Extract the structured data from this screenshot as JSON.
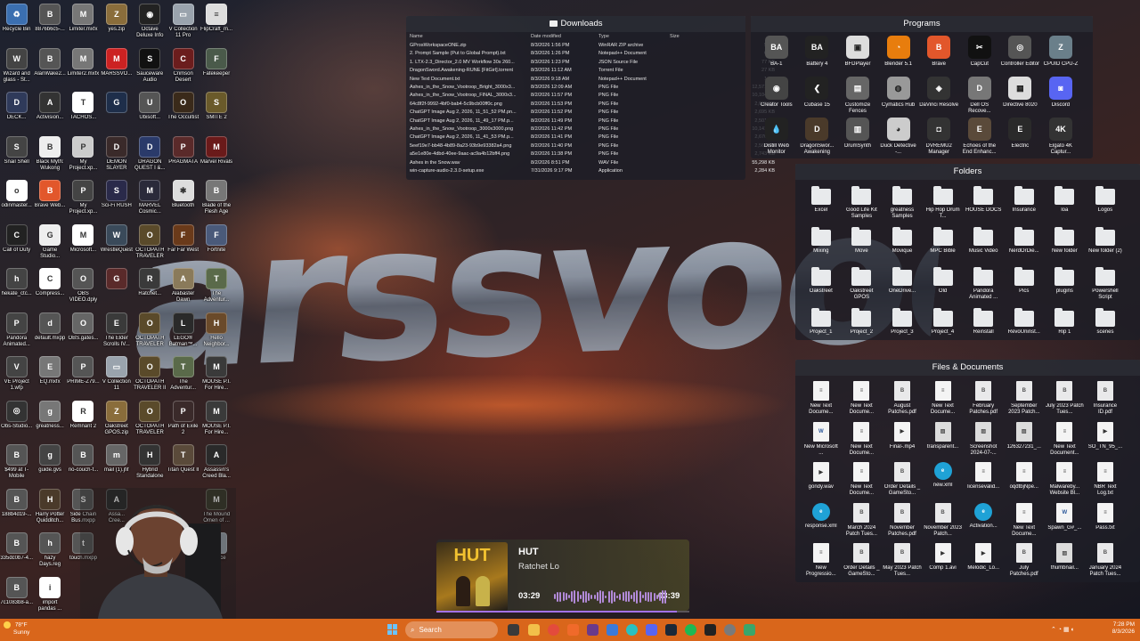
{
  "wallpaper": {
    "title": "arssvoodoo"
  },
  "desktop_icons": [
    {
      "label": "Recycle Bin",
      "icon": "recycle-bin",
      "color": "#3b6fb0",
      "glyph": "♻"
    },
    {
      "label": "8876b6c5-...",
      "icon": "brave",
      "color": "#555",
      "glyph": "B"
    },
    {
      "label": "Limiter.mxfx",
      "icon": "audio",
      "color": "#777",
      "glyph": "M"
    },
    {
      "label": "yes.zip",
      "icon": "zip",
      "color": "#8a6d3b",
      "glyph": "Z"
    },
    {
      "label": "Octave Deluxe Info",
      "icon": "octave",
      "color": "#222",
      "glyph": "◉"
    },
    {
      "label": "V Collection 11 Pro",
      "icon": "folder",
      "color": "#9aa3ad",
      "glyph": "▭"
    },
    {
      "label": "FlipCraft_m...",
      "icon": "document",
      "color": "#ddd",
      "glyph": "≡"
    },
    {
      "label": "Wizard and glass - St...",
      "icon": "document",
      "color": "#444",
      "glyph": "W"
    },
    {
      "label": "AlanWake2...",
      "icon": "brave",
      "color": "#555",
      "glyph": "B"
    },
    {
      "label": "Limiter2.mxfx",
      "icon": "audio",
      "color": "#777",
      "glyph": "M"
    },
    {
      "label": "MARSSVO...",
      "icon": "document",
      "color": "#c22",
      "glyph": "M"
    },
    {
      "label": "Sauceware Audio",
      "icon": "app",
      "color": "#111",
      "glyph": "S"
    },
    {
      "label": "Crimson Desert",
      "icon": "game",
      "color": "#6b1d1d",
      "glyph": "C"
    },
    {
      "label": "Fatekeeper",
      "icon": "game",
      "color": "#4a5a4a",
      "glyph": "F"
    },
    {
      "label": "DECK...",
      "icon": "game",
      "color": "#2f3a5a",
      "glyph": "D"
    },
    {
      "label": "Activision...",
      "icon": "shortcut",
      "color": "#333",
      "glyph": "A"
    },
    {
      "label": "TACHOS...",
      "icon": "document",
      "color": "#fff",
      "glyph": "T"
    },
    {
      "label": "",
      "icon": "game",
      "color": "#1e2e4a",
      "glyph": "G"
    },
    {
      "label": "Ubisoft...",
      "icon": "brave",
      "color": "#555",
      "glyph": "U"
    },
    {
      "label": "The Occultist",
      "icon": "game",
      "color": "#3a2a1a",
      "glyph": "O"
    },
    {
      "label": "SMITE 2",
      "icon": "game",
      "color": "#6a5a2a",
      "glyph": "S"
    },
    {
      "label": "Snail Shell",
      "icon": "game",
      "color": "#444",
      "glyph": "S"
    },
    {
      "label": "Black Myth: Wukong",
      "icon": "document",
      "color": "#eee",
      "glyph": "B"
    },
    {
      "label": "My Project.xp...",
      "icon": "document",
      "color": "#ccc",
      "glyph": "P"
    },
    {
      "label": "DEMON SLAYER",
      "icon": "game",
      "color": "#3a2a2a",
      "glyph": "D"
    },
    {
      "label": "DRAGON QUEST I &...",
      "icon": "game",
      "color": "#2a3a6a",
      "glyph": "D"
    },
    {
      "label": "PRAGMATA",
      "icon": "game",
      "color": "#5a2a2a",
      "glyph": "P"
    },
    {
      "label": "Marvel Rivals",
      "icon": "game",
      "color": "#6a1a1a",
      "glyph": "M"
    },
    {
      "label": "odinmaster...",
      "icon": "document",
      "color": "#fff",
      "glyph": "o"
    },
    {
      "label": "Brave Web...",
      "icon": "brave",
      "color": "#e2572b",
      "glyph": "B"
    },
    {
      "label": "My Project.xp...",
      "icon": "document",
      "color": "#444",
      "glyph": "P"
    },
    {
      "label": "Sci-Fi RUSH",
      "icon": "game",
      "color": "#2a2a4a",
      "glyph": "S"
    },
    {
      "label": "MARVEL Cosmic...",
      "icon": "game",
      "color": "#2a2a3a",
      "glyph": "M"
    },
    {
      "label": "Bluetooth",
      "icon": "bluetooth",
      "color": "#ddd",
      "glyph": "✱"
    },
    {
      "label": "Blade of the Flesh Age",
      "icon": "game",
      "color": "#777",
      "glyph": "B"
    },
    {
      "label": "Call of Duty",
      "icon": "game",
      "color": "#222",
      "glyph": "C"
    },
    {
      "label": "Game Studio...",
      "icon": "document",
      "color": "#eee",
      "glyph": "G"
    },
    {
      "label": "Microsoft...",
      "icon": "document",
      "color": "#fff",
      "glyph": "M"
    },
    {
      "label": "WrestleQuest",
      "icon": "game",
      "color": "#3a4a5a",
      "glyph": "W"
    },
    {
      "label": "OCTOPATH TRAVELER",
      "icon": "game",
      "color": "#5a4a2a",
      "glyph": "O"
    },
    {
      "label": "Far Far West",
      "icon": "game",
      "color": "#6a3a1a",
      "glyph": "F"
    },
    {
      "label": "Fortnite",
      "icon": "game",
      "color": "#4a5a7a",
      "glyph": "F"
    },
    {
      "label": "hekate_ctc...",
      "icon": "document",
      "color": "#444",
      "glyph": "h"
    },
    {
      "label": "Compress...",
      "icon": "document",
      "color": "#fff",
      "glyph": "C"
    },
    {
      "label": "OBS VIDEO.dply",
      "icon": "document",
      "color": "#555",
      "glyph": "O"
    },
    {
      "label": "",
      "icon": "game",
      "color": "#5a2a2a",
      "glyph": "G"
    },
    {
      "label": "Ratchet...",
      "icon": "game",
      "color": "#3a3a3a",
      "glyph": "R"
    },
    {
      "label": "Alabaster Dawn",
      "icon": "game",
      "color": "#8a7a5a",
      "glyph": "A"
    },
    {
      "label": "The Adventur...",
      "icon": "game",
      "color": "#5a6a4a",
      "glyph": "T"
    },
    {
      "label": "Pandora Animated...",
      "icon": "document",
      "color": "#444",
      "glyph": "P"
    },
    {
      "label": "default.mxpp",
      "icon": "document",
      "color": "#555",
      "glyph": "d"
    },
    {
      "label": "OBS.gates...",
      "icon": "document",
      "color": "#666",
      "glyph": "O"
    },
    {
      "label": "The Elder Scrolls IV...",
      "icon": "game",
      "color": "#3a3a3a",
      "glyph": "E"
    },
    {
      "label": "OCTOPATH TRAVELER",
      "icon": "game",
      "color": "#5a4a2a",
      "glyph": "O"
    },
    {
      "label": "LEGO® Batman™...",
      "icon": "game",
      "color": "#2a2a2a",
      "glyph": "L"
    },
    {
      "label": "Hello Neighbor...",
      "icon": "game",
      "color": "#6a4a2a",
      "glyph": "H"
    },
    {
      "label": "VE Project 1.wfp",
      "icon": "document",
      "color": "#444",
      "glyph": "V"
    },
    {
      "label": "EQ.mxfx",
      "icon": "audio",
      "color": "#777",
      "glyph": "E"
    },
    {
      "label": "PRIME-Z79...",
      "icon": "document",
      "color": "#555",
      "glyph": "P"
    },
    {
      "label": "V Collection 11",
      "icon": "folder",
      "color": "#9aa3ad",
      "glyph": "▭"
    },
    {
      "label": "OCTOPATH TRAVELER II",
      "icon": "game",
      "color": "#5a4a2a",
      "glyph": "O"
    },
    {
      "label": "The Adventur...",
      "icon": "game",
      "color": "#5a6a4a",
      "glyph": "T"
    },
    {
      "label": "MOUSE P.I. For Hire...",
      "icon": "game",
      "color": "#3a3a3a",
      "glyph": "M"
    },
    {
      "label": "Obs-Studio...",
      "icon": "app",
      "color": "#333",
      "glyph": "◎"
    },
    {
      "label": "greatness...",
      "icon": "audio",
      "color": "#777",
      "glyph": "g"
    },
    {
      "label": "Remnant 2",
      "icon": "document",
      "color": "#fff",
      "glyph": "R"
    },
    {
      "label": "Oakstreet GPOS.zip",
      "icon": "zip",
      "color": "#8a6d3b",
      "glyph": "Z"
    },
    {
      "label": "OCTOPATH TRAVELER",
      "icon": "game",
      "color": "#5a4a2a",
      "glyph": "O"
    },
    {
      "label": "Path of Exile 2",
      "icon": "game",
      "color": "#3a2a2a",
      "glyph": "P"
    },
    {
      "label": "MOUSE P.I. For Hire...",
      "icon": "game",
      "color": "#3a3a3a",
      "glyph": "M"
    },
    {
      "label": "$499 at T-Mobile",
      "icon": "brave",
      "color": "#555",
      "glyph": "B"
    },
    {
      "label": "guide.gvs",
      "icon": "document",
      "color": "#444",
      "glyph": "g"
    },
    {
      "label": "rio-couch-f...",
      "icon": "brave",
      "color": "#555",
      "glyph": "B"
    },
    {
      "label": "mail (1).jfif",
      "icon": "document",
      "color": "#666",
      "glyph": "m"
    },
    {
      "label": "Hybrid Standalone",
      "icon": "app",
      "color": "#333",
      "glyph": "H"
    },
    {
      "label": "Titan Quest II",
      "icon": "game",
      "color": "#5a4a3a",
      "glyph": "T"
    },
    {
      "label": "Assassin's Creed Bla...",
      "icon": "game",
      "color": "#2a2a2a",
      "glyph": "A"
    },
    {
      "label": "188b4d19-...",
      "icon": "brave",
      "color": "#555",
      "glyph": "B"
    },
    {
      "label": "Harry Potter Quidditch...",
      "icon": "game",
      "color": "#4a3a2a",
      "glyph": "H"
    },
    {
      "label": "Side Chain Bus.mxpp",
      "icon": "document",
      "color": "#555",
      "glyph": "S"
    },
    {
      "label": "Assa... Cree...",
      "icon": "game",
      "color": "#2a2a2a",
      "glyph": "A"
    },
    {
      "label": "",
      "icon": "blank",
      "color": "transparent",
      "glyph": ""
    },
    {
      "label": "",
      "icon": "blank",
      "color": "transparent",
      "glyph": ""
    },
    {
      "label": "The Mound Omen of ...",
      "icon": "game",
      "color": "#3a3a2a",
      "glyph": "M"
    },
    {
      "label": "335dc0b7-4...",
      "icon": "brave",
      "color": "#555",
      "glyph": "B"
    },
    {
      "label": "hazy Days.reg",
      "icon": "document",
      "color": "#555",
      "glyph": "h"
    },
    {
      "label": "touch.mxpp",
      "icon": "document",
      "color": "#555",
      "glyph": "t"
    },
    {
      "label": "",
      "icon": "blank",
      "color": "transparent",
      "glyph": ""
    },
    {
      "label": "",
      "icon": "blank",
      "color": "transparent",
      "glyph": ""
    },
    {
      "label": "",
      "icon": "blank",
      "color": "transparent",
      "glyph": ""
    },
    {
      "label": "...space",
      "icon": "folder",
      "color": "#9aa3ad",
      "glyph": "▭"
    },
    {
      "label": "7c1083b8-a...",
      "icon": "brave",
      "color": "#555",
      "glyph": "B"
    },
    {
      "label": "import pandas ...",
      "icon": "document",
      "color": "#fff",
      "glyph": "i"
    }
  ],
  "downloads": {
    "title": "Downloads",
    "columns": [
      "Name",
      "Date modified",
      "Type",
      "Size"
    ],
    "rows": [
      [
        "GProsWorkspaceONE.zip",
        "8/3/2026 1:56 PM",
        "WinRAR ZIP archive",
        "5 KB"
      ],
      [
        "2. Prompt Sample (Put to Global Prompt).txt",
        "8/3/2026 1:26 PM",
        "Notepad++ Document",
        "6 KB"
      ],
      [
        "1. LTX-2.3_Director_2.0 MV Workflow 30s 260...",
        "8/3/2026 1:23 PM",
        "JSON Source File",
        "77 KB"
      ],
      [
        "DragonSword.Awakening-RUNE [FitGirl].torrent",
        "8/3/2026 11:12 AM",
        "Torrent File",
        "27 KB"
      ],
      [
        "New Text Document.txt",
        "8/3/2026 9:18 AM",
        "Notepad++ Document",
        "1 KB"
      ],
      [
        "Ashes_in_the_Snow_Vootroop_Bright_3000x3...",
        "8/3/2026 12:09 AM",
        "PNG File",
        "12,571 KB"
      ],
      [
        "Ashes_in_the_Snow_Vootroop_FINAL_3000x3...",
        "8/2/2026 11:57 PM",
        "PNG File",
        "10,104 KB"
      ],
      [
        "64c8f2f-9992-4bf0-bab4-5c9bcb00ff0c.png",
        "8/2/2026 11:53 PM",
        "PNG File",
        "2,695 KB"
      ],
      [
        "ChatGPT Image Aug 2, 2026, 11_51_52 PM.pn...",
        "8/2/2026 11:52 PM",
        "PNG File",
        "2,695 KB"
      ],
      [
        "ChatGPT Image Aug 2, 2026, 11_49_17 PM.p...",
        "8/2/2026 11:49 PM",
        "PNG File",
        "2,501 KB"
      ],
      [
        "Ashes_in_the_Snow_Vootroop_3000x3000.png",
        "8/2/2026 11:42 PM",
        "PNG File",
        "10,141 KB"
      ],
      [
        "ChatGPT Image Aug 2, 2026, 11_41_53 PM.p...",
        "8/2/2026 11:41 PM",
        "PNG File",
        "2,670 KB"
      ],
      [
        "5eef19e7-bb48-4b89-8a23-93b9e93382a4.png",
        "8/2/2026 11:40 PM",
        "PNG File",
        "2,561 KB"
      ],
      [
        "a5e1e80e-4dbd-40ee-9aac-ac9a4b12bff4.png",
        "8/2/2026 11:38 PM",
        "PNG File",
        "2,743 KB"
      ],
      [
        "Ashes in the Snow.wav",
        "8/2/2026 8:51 PM",
        "WAV File",
        "55,298 KB"
      ],
      [
        "win-capture-audio-2.3.0-setup.exe",
        "7/31/2026 9:17 PM",
        "Application",
        "2,284 KB"
      ]
    ]
  },
  "programs": {
    "title": "Programs",
    "items": [
      {
        "label": "BA-1",
        "color": "#555",
        "glyph": "BA"
      },
      {
        "label": "Battery 4",
        "color": "#222",
        "glyph": "BA"
      },
      {
        "label": "BFDPlayer",
        "color": "#ddd",
        "glyph": "▣"
      },
      {
        "label": "Blender 5.1",
        "color": "#e87d0d",
        "glyph": "◔"
      },
      {
        "label": "Brave",
        "color": "#e2572b",
        "glyph": "B"
      },
      {
        "label": "CapCut",
        "color": "#111",
        "glyph": "✂"
      },
      {
        "label": "Controller Editor",
        "color": "#555",
        "glyph": "◎"
      },
      {
        "label": "CPUID CPU-Z",
        "color": "#6a7f8a",
        "glyph": "Z"
      },
      {
        "label": "Creator Tools",
        "color": "#444",
        "glyph": "◉"
      },
      {
        "label": "Cubase 15",
        "color": "#222",
        "glyph": "❮"
      },
      {
        "label": "Customize Fences",
        "color": "#666",
        "glyph": "▤"
      },
      {
        "label": "Cymatics Hub",
        "color": "#999",
        "glyph": "◍"
      },
      {
        "label": "DaVinci Resolve",
        "color": "#333",
        "glyph": "◈"
      },
      {
        "label": "Dell OS Recove...",
        "color": "#777",
        "glyph": "D"
      },
      {
        "label": "Directive 8020",
        "color": "#ddd",
        "glyph": "▦"
      },
      {
        "label": "Discord",
        "color": "#5865f2",
        "glyph": "◙"
      },
      {
        "label": "Distill Web Monitor",
        "color": "#222",
        "glyph": "💧"
      },
      {
        "label": "DragonSwor... Awakening",
        "color": "#4a3a2a",
        "glyph": "D"
      },
      {
        "label": "DrumSynth",
        "color": "#555",
        "glyph": "▥"
      },
      {
        "label": "Duck Detective -...",
        "color": "#ccc",
        "glyph": "◕"
      },
      {
        "label": "DVREMU2 Manager",
        "color": "#333",
        "glyph": "◘"
      },
      {
        "label": "Echoes of the End Enhanc...",
        "color": "#5a4a3a",
        "glyph": "E"
      },
      {
        "label": "Electric",
        "color": "#2a2a2a",
        "glyph": "E"
      },
      {
        "label": "Elgato 4K Captur...",
        "color": "#333",
        "glyph": "4K"
      }
    ]
  },
  "folders": {
    "title": "Folders",
    "items": [
      "Excel",
      "Good Life Kit Samples",
      "greatness Samples",
      "Hip Hop Drum T...",
      "HOUSE DOCS",
      "Insurance",
      "loa",
      "Logos",
      "Mixing",
      "Move",
      "Movique",
      "MPC Bible",
      "Music Video",
      "NerdOrDie...",
      "New folder",
      "New folder (2)",
      "Oakstreet",
      "Oakstreet GPOS",
      "OneDrive...",
      "Old",
      "Pandora Animated ...",
      "Pics",
      "plugins",
      "Powershell Script",
      "Project_1",
      "Project_2",
      "Project_3",
      "Project_4",
      "Reinstall",
      "RevoUninst...",
      "Rip 1",
      "scenes"
    ]
  },
  "files": {
    "title": "Files & Documents",
    "items": [
      {
        "label": "New Text Docume...",
        "kind": "txt"
      },
      {
        "label": "New Text Docume...",
        "kind": "txt"
      },
      {
        "label": "August Patches.pdf",
        "kind": "pdf"
      },
      {
        "label": "New Text Docume...",
        "kind": "txt"
      },
      {
        "label": "February Patches.pdf",
        "kind": "pdf"
      },
      {
        "label": "September 2023 Patch...",
        "kind": "pdf"
      },
      {
        "label": "July 2023 Patch Tues...",
        "kind": "pdf"
      },
      {
        "label": "Insurance ID.pdf",
        "kind": "pdf"
      },
      {
        "label": "New Microsoft ...",
        "kind": "doc"
      },
      {
        "label": "New Text Docume...",
        "kind": "txt"
      },
      {
        "label": "Final-.mp4",
        "kind": "video"
      },
      {
        "label": "transparent...",
        "kind": "img"
      },
      {
        "label": "Screenshot 2024-07-...",
        "kind": "img"
      },
      {
        "label": "126327231_...",
        "kind": "img"
      },
      {
        "label": "New Text Document...",
        "kind": "txt"
      },
      {
        "label": "SO_TN_95_...",
        "kind": "video"
      },
      {
        "label": "gondy.wav",
        "kind": "video"
      },
      {
        "label": "New Text Docume...",
        "kind": "txt"
      },
      {
        "label": "Order Details _ GameSto...",
        "kind": "pdf"
      },
      {
        "label": "new.xml",
        "kind": "edge"
      },
      {
        "label": "licensevalid...",
        "kind": "txt"
      },
      {
        "label": "oqdtbjNpe...",
        "kind": "txt"
      },
      {
        "label": "Malwareby... Website Bl...",
        "kind": "txt"
      },
      {
        "label": "NBR Text Log.txt",
        "kind": "txt"
      },
      {
        "label": "response.xml",
        "kind": "edge"
      },
      {
        "label": "March 2024 Patch Tues...",
        "kind": "pdf"
      },
      {
        "label": "November Patches.pdf",
        "kind": "pdf"
      },
      {
        "label": "November 2023 Patch...",
        "kind": "pdf"
      },
      {
        "label": "Activation...",
        "kind": "edge"
      },
      {
        "label": "New Text Docume...",
        "kind": "txt"
      },
      {
        "label": "Spawn_G#_...",
        "kind": "doc"
      },
      {
        "label": "Pass.txt",
        "kind": "txt"
      },
      {
        "label": "New Progressio...",
        "kind": "txt"
      },
      {
        "label": "Order Details _ GameSto...",
        "kind": "pdf"
      },
      {
        "label": "May 2023 Patch Tues...",
        "kind": "pdf"
      },
      {
        "label": "Comp 1.avi",
        "kind": "video"
      },
      {
        "label": "Melodic_Lo...",
        "kind": "video"
      },
      {
        "label": "July Patches.pdf",
        "kind": "pdf"
      },
      {
        "label": "thumbnail...",
        "kind": "img"
      },
      {
        "label": "January 2024 Patch Tues...",
        "kind": "pdf"
      }
    ]
  },
  "media": {
    "song_title": "HUT",
    "artist": "Ratchet Lo",
    "elapsed": "03:29",
    "duration": "03:39",
    "progress": 0.95,
    "album_text": "HUT"
  },
  "taskbar": {
    "weather_temp": "78°F",
    "weather_desc": "Sunny",
    "search_placeholder": "Search",
    "time": "7:28 PM",
    "date": "8/3/2026",
    "accent": "#d9661b"
  }
}
